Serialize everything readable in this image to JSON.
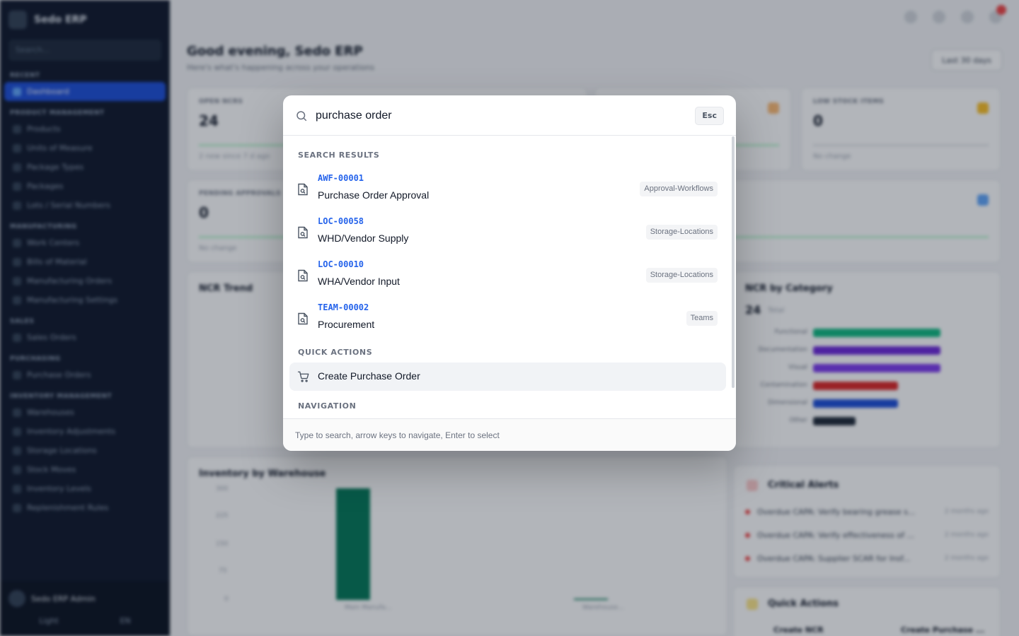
{
  "background": {
    "brand": "Sedo ERP",
    "sidebar_search": "Search...",
    "sections": [
      {
        "title": "RECENT",
        "items": []
      },
      {
        "title": "",
        "items": [
          "Dashboard"
        ]
      },
      {
        "title": "PRODUCT MANAGEMENT",
        "items": [
          "Products",
          "Units of Measure",
          "Package Types",
          "Packages",
          "Lots / Serial Numbers"
        ]
      },
      {
        "title": "MANUFACTURING",
        "items": [
          "Work Centers",
          "Bills of Material",
          "Manufacturing Orders",
          "Manufacturing Settings"
        ]
      },
      {
        "title": "SALES",
        "items": [
          "Sales Orders"
        ]
      },
      {
        "title": "PURCHASING",
        "items": [
          "Purchase Orders"
        ]
      },
      {
        "title": "INVENTORY MANAGEMENT",
        "items": [
          "Warehouses",
          "Inventory Adjustments",
          "Storage Locations",
          "Stock Moves",
          "Inventory Levels",
          "Replenishment Rules"
        ]
      }
    ],
    "user_name": "Sedo ERP Admin",
    "theme_label": "Light",
    "lang_label": "EN",
    "greeting": "Good evening, Sedo ERP",
    "greeting_sub": "Here's what's happening across your operations",
    "date_range": "Last 30 days",
    "kpi_cards": [
      {
        "label": "OPEN NCRS",
        "value": "24",
        "foot": "2 new since 7 d ago"
      },
      {
        "label": "LOW STOCK ITEMS",
        "value": "0",
        "foot": "No change"
      },
      {
        "label": "PENDING APPROVALS",
        "value": "0",
        "foot": "No change"
      }
    ],
    "ncr_trend_title": "NCR Trend",
    "ncr_category_title": "NCR by Category",
    "ncr_category_total": "24",
    "ncr_category_total_unit": "Total",
    "ncr_categories": [
      {
        "label": "Functional",
        "color": "#10b981",
        "value": 6
      },
      {
        "label": "Documentation",
        "color": "#6d28d9",
        "value": 6
      },
      {
        "label": "Visual",
        "color": "#7c3aed",
        "value": 6
      },
      {
        "label": "Contamination",
        "color": "#dc2626",
        "value": 4
      },
      {
        "label": "Dimensional",
        "color": "#1d4ed8",
        "value": 4
      },
      {
        "label": "Other",
        "color": "#1f2937",
        "value": 2
      }
    ],
    "inventory_title": "Inventory by Warehouse",
    "inventory_axis": [
      "300",
      "225",
      "150",
      "75",
      "0"
    ],
    "warehouses": [
      {
        "label": "Main Manufa...",
        "value": 300
      },
      {
        "label": "Warehouse...",
        "value": 2
      }
    ],
    "critical_alerts_title": "Critical Alerts",
    "alerts": [
      {
        "text": "Overdue CAPA: Verify bearing grease s...",
        "time": "2 months ago"
      },
      {
        "text": "Overdue CAPA: Verify effectiveness of ...",
        "time": "2 months ago"
      },
      {
        "text": "Overdue CAPA: Supplier SCAR for Insf...",
        "time": "2 months ago"
      }
    ],
    "quick_actions_title": "Quick Actions",
    "quick_action_buttons": [
      "Create NCR",
      "Create Purchase ..."
    ]
  },
  "palette": {
    "query": "purchase order",
    "esc_label": "Esc",
    "results_title": "SEARCH RESULTS",
    "results": [
      {
        "code": "AWF-00001",
        "name": "Purchase Order Approval",
        "tag": "Approval-Workflows"
      },
      {
        "code": "LOC-00058",
        "name": "WHD/Vendor Supply",
        "tag": "Storage-Locations"
      },
      {
        "code": "LOC-00010",
        "name": "WHA/Vendor Input",
        "tag": "Storage-Locations"
      },
      {
        "code": "TEAM-00002",
        "name": "Procurement",
        "tag": "Teams"
      }
    ],
    "quick_actions_title": "QUICK ACTIONS",
    "quick_actions": [
      {
        "label": "Create Purchase Order",
        "icon": "cart-icon"
      }
    ],
    "navigation_title": "NAVIGATION",
    "footer_hint": "Type to search, arrow keys to navigate, Enter to select"
  },
  "colors": {
    "accent": "#2563eb",
    "sidebar_bg": "#0f172a",
    "overlay": "#111827"
  }
}
